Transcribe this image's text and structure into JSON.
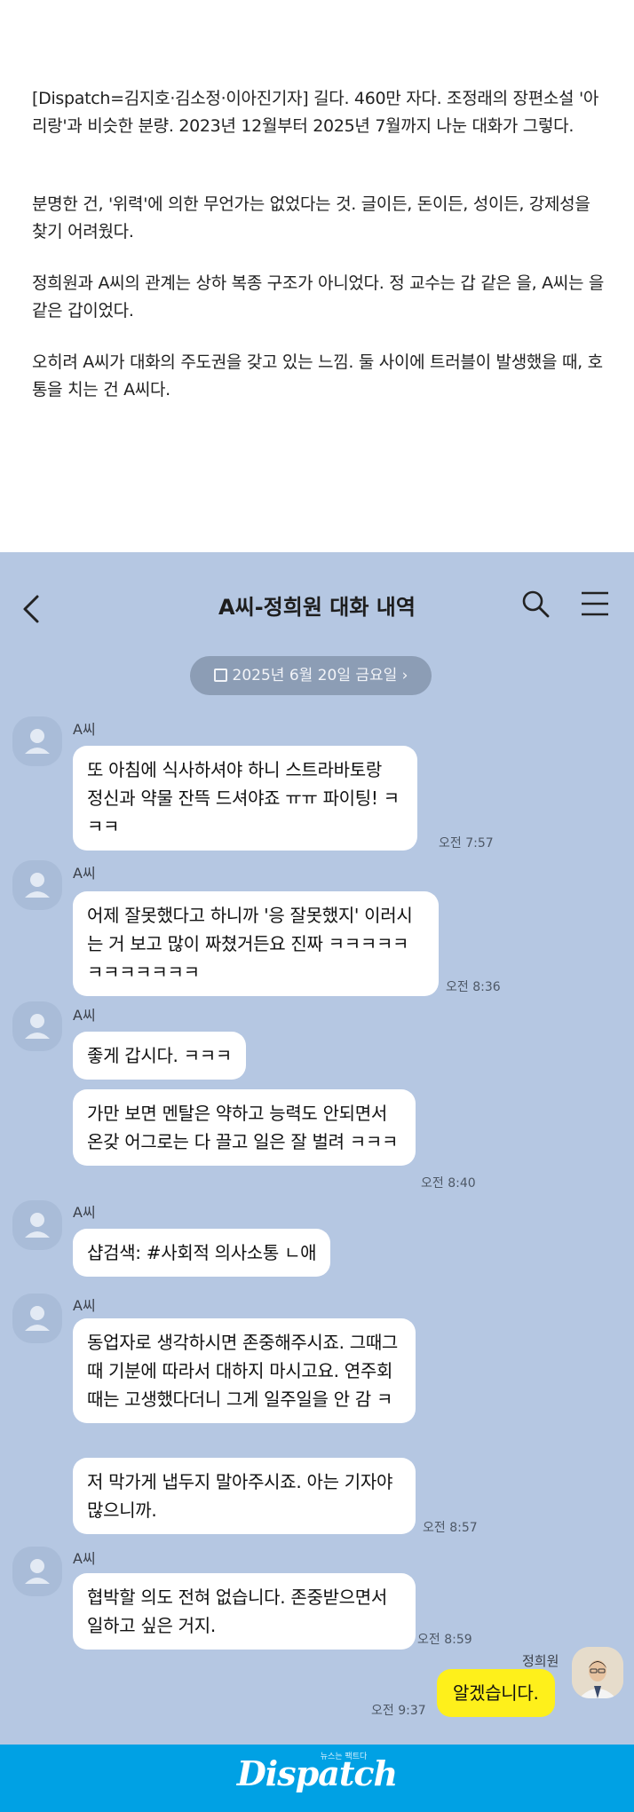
{
  "article": {
    "paragraphs": [
      "[Dispatch=김지호·김소정·이아진기자] 길다. 460만 자다. 조정래의 장편소설 '아리랑'과 비슷한 분량. 2023년 12월부터 2025년 7월까지 나눈 대화가 그렇다.",
      "분명한 건, '위력'에 의한 무언가는 없었다는 것. 글이든, 돈이든, 성이든, 강제성을 찾기 어려웠다.",
      "정희원과 A씨의 관계는 상하 복종 구조가 아니었다. 정 교수는 갑 같은 을, A씨는 을 같은 갑이었다.",
      "오히려 A씨가 대화의 주도권을 갖고 있는 느낌. 둘 사이에 트러블이 발생했을 때, 호통을 치는 건 A씨다."
    ]
  },
  "chat": {
    "title": "A씨-정희원 대화 내역",
    "date_label": "2025년 6월 20일 금요일 ›",
    "icons": {
      "back": "back-arrow-icon",
      "search": "search-icon",
      "menu": "menu-icon",
      "calendar": "calendar-icon"
    },
    "sender_name": "A씨",
    "me_name": "정희원",
    "bubbles": [
      "또 아침에 식사하셔야 하니 스트라바토랑 정신과 약물 잔뜩 드셔야죠 ㅠㅠ 파이팅! ㅋㅋㅋ",
      "어제 잘못했다고 하니까 '응 잘못했지' 이러시는 거 보고 많이 짜쳤거든요 진짜 ㅋㅋㅋㅋㅋㅋㅋㅋㅋㅋㅋㅋ",
      "좋게 갑시다. ㅋㅋㅋ",
      "가만 보면 멘탈은 약하고 능력도 안되면서 온갖 어그로는 다 끌고 일은 잘 벌려 ㅋㅋㅋ",
      "샵검색: #사회적 의사소통 ㄴ애",
      "동업자로 생각하시면 존중해주시죠. 그때그때 기분에 따라서 대하지 마시고요. 연주회 때는 고생했다더니 그게 일주일을 안 감 ㅋ",
      "저 막가게 냅두지 말아주시죠. 아는 기자야 많으니까.",
      "협박할 의도 전혀 없습니다. 존중받으면서 일하고 싶은 거지.",
      "알겠습니다."
    ],
    "times": [
      "오전 7:57",
      "오전 8:36",
      "오전 8:40",
      "오전 8:57",
      "오전 8:59",
      "오전 9:37"
    ],
    "colors": {
      "background": "#b5c7e2",
      "my_bubble": "#fef01b",
      "their_bubble": "#ffffff"
    }
  },
  "footer": {
    "tagline": "뉴스는 팩트다",
    "logo": "Dispatch",
    "color": "#00a1e4"
  }
}
